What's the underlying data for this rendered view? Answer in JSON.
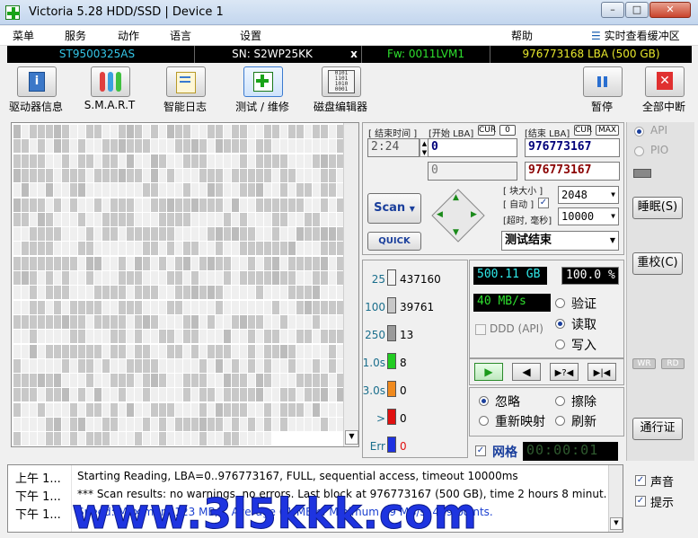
{
  "window": {
    "title": "Victoria 5.28 HDD/SSD | Device 1",
    "min": "–",
    "max": "□",
    "close": "✕"
  },
  "menu": {
    "items": [
      "菜单",
      "服务",
      "动作",
      "语言",
      "设置",
      "帮助"
    ],
    "realtime": "实时查看缓冲区"
  },
  "info": {
    "model": "ST9500325AS",
    "sn": "SN: S2WP25KK",
    "close": "x",
    "fw": "Fw: 0011LVM1",
    "lba": "976773168 LBA (500 GB)"
  },
  "colors": {
    "model": "#34c6e8",
    "fw": "#2ee02e",
    "lba": "#e8e82c",
    "sn": "#ffffff",
    "accent": "#1a3f9c"
  },
  "toolbar": [
    {
      "label": "驱动器信息",
      "icon": "info-icon"
    },
    {
      "label": "S.M.A.R.T",
      "icon": "smart-icon"
    },
    {
      "label": "智能日志",
      "icon": "log-icon"
    },
    {
      "label": "测试 / 维修",
      "icon": "test-repair-icon"
    },
    {
      "label": "磁盘编辑器",
      "icon": "disk-editor-icon"
    },
    {
      "label": "暂停",
      "icon": "pause-icon"
    },
    {
      "label": "全部中断",
      "icon": "abort-icon"
    }
  ],
  "scan": {
    "end_time_label": "[ 结束时间 ]",
    "end_time": "2:24",
    "start_lba_label": "[开始 LBA]",
    "cur": "CUR",
    "zero": "0",
    "end_lba_label": "[结束 LBA]",
    "max": "MAX",
    "start_lba": "0",
    "end_lba": "976773167",
    "start_lba2": "0",
    "end_lba2": "976773167",
    "scan_button": "Scan",
    "quick_button": "QUICK",
    "block_size_label": "[ 块大小 ]",
    "auto_label": "[ 自动 ]",
    "timeout_label": "[超时, 毫秒]",
    "block_size": "2048",
    "timeout": "10000",
    "status": "测试结束"
  },
  "legend": [
    {
      "label": "25",
      "count": "437160",
      "color": "#f4f4f4"
    },
    {
      "label": "100",
      "count": "39761",
      "color": "#c8c8c8"
    },
    {
      "label": "250",
      "count": "13",
      "color": "#9a9a9a"
    },
    {
      "label": "1.0s",
      "count": "8",
      "color": "#22cc22"
    },
    {
      "label": "3.0s",
      "count": "0",
      "color": "#f08a1e"
    },
    {
      "label": ">",
      "count": "0",
      "color": "#e01010"
    },
    {
      "label": "Err",
      "count": "0",
      "color": "#1e32e0"
    }
  ],
  "stats": {
    "size": "500.11 GB",
    "percent": "100.0 %",
    "speed": "40 MB/s",
    "ddd": "DDD (API)",
    "verify": "验证",
    "read": "读取",
    "write": "写入",
    "timer": "00:00:01",
    "grid": "网格"
  },
  "actions": {
    "ignore": "忽略",
    "erase": "擦除",
    "remap": "重新映射",
    "refresh": "刷新"
  },
  "right": {
    "api": "API",
    "pio": "PIO",
    "sleep": "睡眠(S)",
    "recal": "重校(C)",
    "wr": "WR",
    "rd": "RD",
    "passport": "通行证",
    "sound": "声音",
    "hint": "提示"
  },
  "log": [
    {
      "time": "上午 1...",
      "msg": "Starting Reading, LBA=0..976773167, FULL, sequential access, timeout 10000ms",
      "color": "#000000"
    },
    {
      "time": "下午 1...",
      "msg": "*** Scan results: no warnings, no errors. Last block at 976773167 (500 GB), time 2 hours 8 minut...",
      "color": "#000000"
    },
    {
      "time": "下午 1...",
      "msg": "Speed: Maximum 123 MB/s. Average 61 MB/s. Minimum 19 MB/s. 419 points.",
      "color": "#1a3fd0"
    }
  ],
  "watermark": "www.3l5kkk.com"
}
